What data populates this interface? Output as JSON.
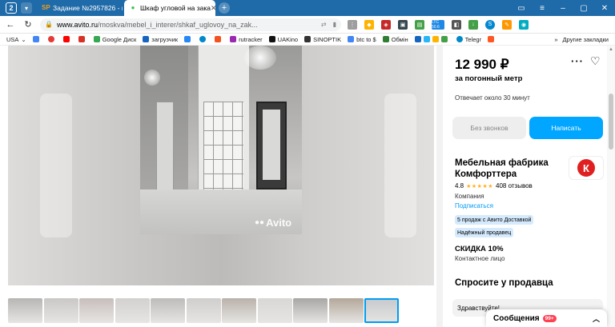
{
  "browser": {
    "tab_count": "2",
    "tabs": [
      {
        "title": "Задание №2957826 - про"
      },
      {
        "title": "Шкаф угловой на зака"
      }
    ],
    "url_host": "www.avito.ru",
    "url_path": "/moskva/mebel_i_interer/shkaf_uglovoy_na_zak..."
  },
  "bookmarks": {
    "items": [
      {
        "label": "USA",
        "color": "#555555"
      },
      {
        "label": "",
        "color": "#4285f4"
      },
      {
        "label": "",
        "color": "#e53935"
      },
      {
        "label": "",
        "color": "#ff0000"
      },
      {
        "label": "",
        "color": "#d93025"
      },
      {
        "label": "Google Диск",
        "color": "#34a853"
      },
      {
        "label": "загрузчик",
        "color": "#1565c0"
      },
      {
        "label": "",
        "color": "#2787f5"
      },
      {
        "label": "",
        "color": "#0088cc"
      },
      {
        "label": "",
        "color": "#f4511e"
      },
      {
        "label": "rutracker",
        "color": "#9c27b0"
      },
      {
        "label": "UAKino",
        "color": "#111111"
      },
      {
        "label": "SINOPTIK",
        "color": "#333333"
      },
      {
        "label": "btc to $",
        "color": "#4285f4"
      },
      {
        "label": "Обмін",
        "color": "#2e7d32"
      }
    ],
    "other_label": "Другие закладки"
  },
  "extensions": {
    "ltc_label": "LTC 50.6",
    "telegram_label": "Telegr"
  },
  "gallery": {
    "watermark": "Avito",
    "thumbs": [
      "#b7b6b4",
      "#c9c8c6",
      "#c7bebc",
      "#d2d1cf",
      "#bdbcba",
      "#cfcecc",
      "#b9b2aa",
      "#d8d7d5",
      "#a9a7a5",
      "#b3a79a",
      "#c5c8cc"
    ],
    "active_thumb_index": 10
  },
  "listing": {
    "price": "12 990 ₽",
    "price_unit": "за погонный метр",
    "reply_time": "Отвечает около 30 минут",
    "no_calls_label": "Без звонков",
    "write_label": "Написать"
  },
  "seller": {
    "name": "Мебельная фабрика Комфорттера",
    "rating": "4.8",
    "stars": "★★★★★",
    "reviews": "408 отзывов",
    "type": "Компания",
    "subscribe_label": "Подписаться",
    "badges": [
      "5 продаж с Авито Доставкой",
      "Надёжный продавец"
    ],
    "discount": "СКИДКА 10%",
    "contact_person": "Контактное лицо",
    "logo_letter": "К",
    "logo_color": "#e02020"
  },
  "ask": {
    "title": "Спросите у продавца",
    "input_value": "Здравствуйте!"
  },
  "messages": {
    "label": "Сообщения",
    "count": "99+"
  },
  "colors": {
    "accent": "#00a6ff",
    "chrome": "#1f6aa8",
    "badge": "#d5ebfd"
  }
}
